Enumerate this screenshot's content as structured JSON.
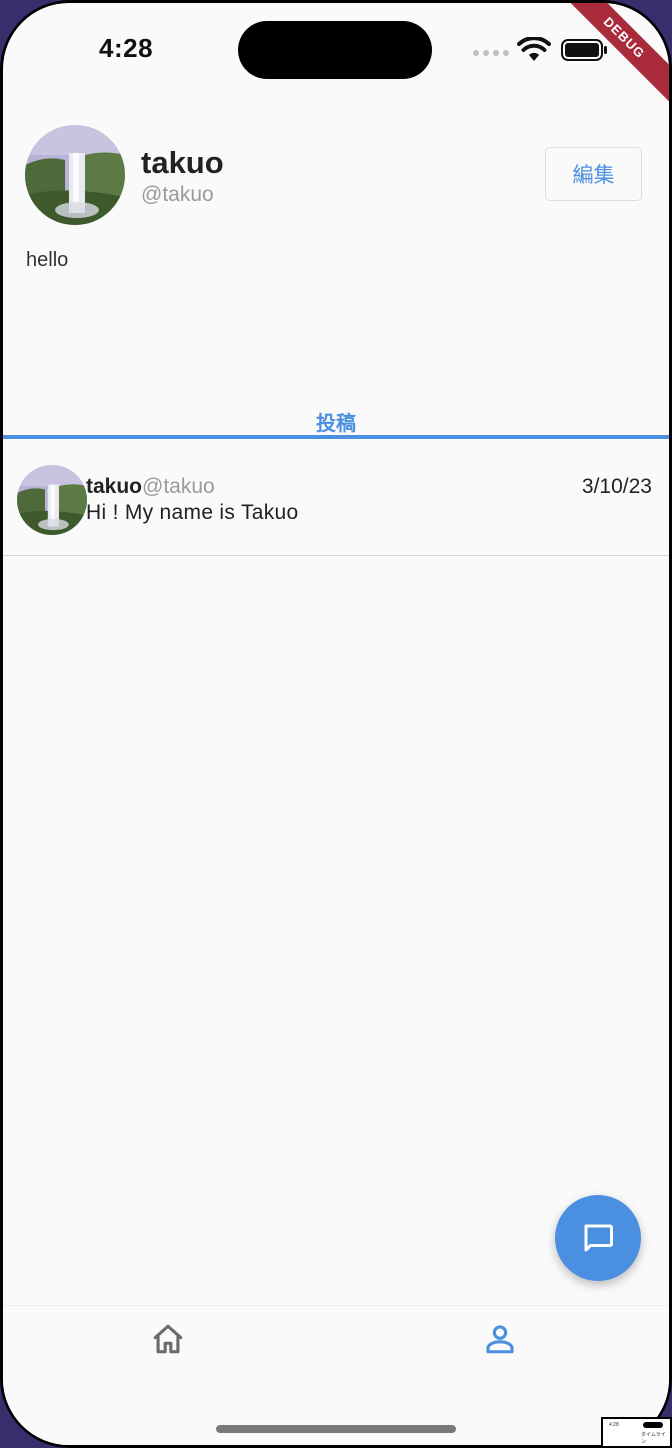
{
  "status_bar": {
    "time": "4:28",
    "debug_banner": "DEBUG"
  },
  "profile": {
    "name": "takuo",
    "handle": "@takuo",
    "bio": "hello",
    "edit_label": "編集"
  },
  "tabs": [
    {
      "label": "投稿",
      "active": true
    }
  ],
  "posts": [
    {
      "name": "takuo",
      "handle": "@takuo",
      "date": "3/10/23",
      "text": "Hi ! My name is Takuo"
    }
  ],
  "fab": {
    "icon": "chat-bubble-icon"
  },
  "bottom_nav": [
    {
      "icon": "home-icon",
      "active": false
    },
    {
      "icon": "person-icon",
      "active": true
    }
  ],
  "colors": {
    "accent": "#4a8fe0",
    "inactive": "#6b6b6b",
    "debug": "#a82a3b"
  },
  "mini_thumbnail": {
    "time": "4:28",
    "label": "タイムライン"
  }
}
